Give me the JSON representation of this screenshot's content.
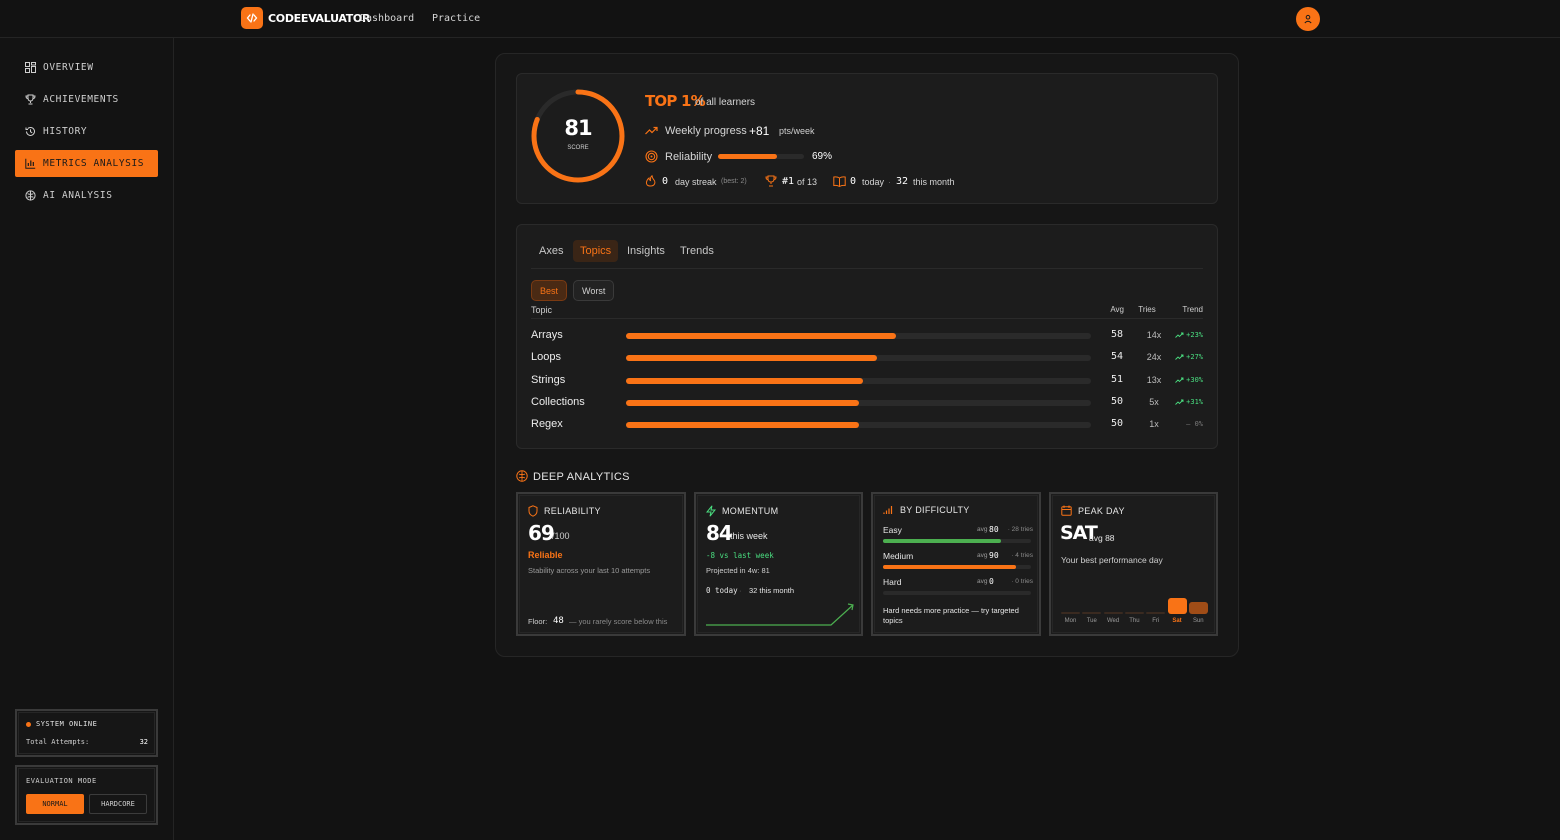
{
  "app": {
    "logo_text": "CODEEVALUATOR",
    "nav": [
      "Dashboard",
      "Practice"
    ]
  },
  "sidebar": {
    "items": [
      {
        "label": "OVERVIEW",
        "icon": "dashboard-icon"
      },
      {
        "label": "ACHIEVEMENTS",
        "icon": "trophy-icon"
      },
      {
        "label": "HISTORY",
        "icon": "history-icon"
      },
      {
        "label": "METRICS ANALYSIS",
        "icon": "bar-chart-icon",
        "active": true
      },
      {
        "label": "AI ANALYSIS",
        "icon": "brain-icon"
      }
    ],
    "system": {
      "status": "SYSTEM ONLINE",
      "attempts_label": "Total Attempts:",
      "attempts_value": "32"
    },
    "eval_mode": {
      "title": "EVALUATION MODE",
      "options": [
        "NORMAL",
        "HARDCORE"
      ],
      "selected": "NORMAL"
    }
  },
  "score": {
    "value": "81",
    "value_num": 81,
    "label": "SCORE",
    "rank": "TOP 1%",
    "rank_suffix": "of all learners",
    "weekly_label": "Weekly progress",
    "weekly_value": "+81",
    "weekly_unit": "pts/week",
    "reliability_label": "Reliability",
    "reliability_value": "69%",
    "reliability_num": 69,
    "streak_value": "0",
    "streak_label": "day streak",
    "streak_best": "(best: 2)",
    "rank_pos": "#1",
    "rank_of": "of 13",
    "today_value": "0",
    "today_label": "today",
    "month_value": "32",
    "month_label": "this month"
  },
  "tabs": [
    {
      "label": "Axes"
    },
    {
      "label": "Topics",
      "active": true
    },
    {
      "label": "Insights"
    },
    {
      "label": "Trends"
    }
  ],
  "filters": [
    {
      "label": "Best",
      "active": true
    },
    {
      "label": "Worst"
    }
  ],
  "topics_table": {
    "headers": {
      "topic": "Topic",
      "avg": "Avg",
      "tries": "Tries",
      "trend": "Trend"
    },
    "rows": [
      {
        "name": "Arrays",
        "avg": "58",
        "avg_num": 58,
        "tries": "14x",
        "trend": "+23%",
        "trend_up": true
      },
      {
        "name": "Loops",
        "avg": "54",
        "avg_num": 54,
        "tries": "24x",
        "trend": "+27%",
        "trend_up": true
      },
      {
        "name": "Strings",
        "avg": "51",
        "avg_num": 51,
        "tries": "13x",
        "trend": "+30%",
        "trend_up": true
      },
      {
        "name": "Collections",
        "avg": "50",
        "avg_num": 50,
        "tries": "5x",
        "trend": "+31%",
        "trend_up": true
      },
      {
        "name": "Regex",
        "avg": "50",
        "avg_num": 50,
        "tries": "1x",
        "trend": "— 0%",
        "trend_up": false
      }
    ]
  },
  "deep": {
    "title": "DEEP ANALYTICS",
    "reliability": {
      "title": "RELIABILITY",
      "value": "69",
      "unit": "/100",
      "status": "Reliable",
      "desc": "Stability across your last 10 attempts",
      "floor_label": "Floor:",
      "floor_value": "48",
      "floor_note": "— you rarely score below this"
    },
    "momentum": {
      "title": "MOMENTUM",
      "value": "84",
      "unit": "this week",
      "delta": "-8 vs last week",
      "projected": "Projected in 4w: 81",
      "today": "0 today",
      "month": "32 this month"
    },
    "difficulty": {
      "title": "BY DIFFICULTY",
      "levels": [
        {
          "name": "Easy",
          "avg_label": "avg",
          "avg": "80",
          "tries": "· 28 tries",
          "pct": 80,
          "color": "#4caf50"
        },
        {
          "name": "Medium",
          "avg_label": "avg",
          "avg": "90",
          "tries": "· 4 tries",
          "pct": 90,
          "color": "#f97316"
        },
        {
          "name": "Hard",
          "avg_label": "avg",
          "avg": "0",
          "tries": "· 0 tries",
          "pct": 0,
          "color": "#f97316"
        }
      ],
      "note": "Hard needs more practice — try targeted topics"
    },
    "peak": {
      "title": "PEAK DAY",
      "value": "SAT",
      "avg": "avg 88",
      "desc": "Your best performance day",
      "days": [
        "Mon",
        "Tue",
        "Wed",
        "Thu",
        "Fri",
        "Sat",
        "Sun"
      ],
      "best": "Sat"
    }
  },
  "colors": {
    "accent": "#f97316",
    "positive": "#4ade80",
    "bg": "#121212"
  }
}
